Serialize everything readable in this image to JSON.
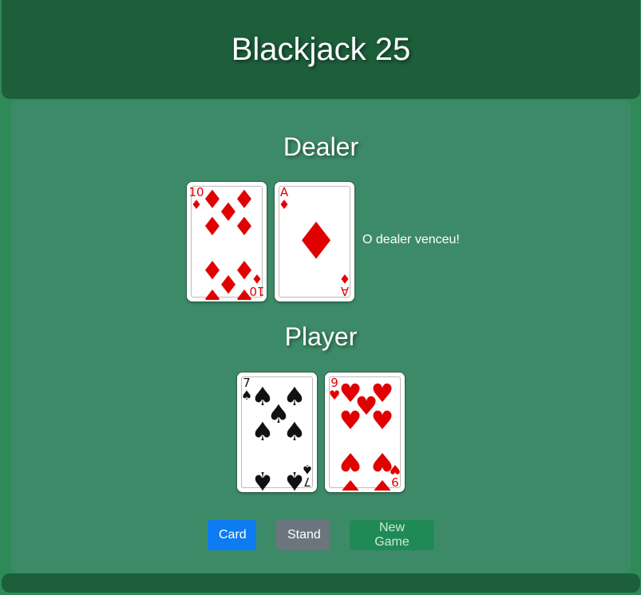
{
  "header": {
    "title": "Blackjack 25"
  },
  "dealer": {
    "title": "Dealer",
    "cards": [
      {
        "rank": "10",
        "suit": "diamonds",
        "color": "red"
      },
      {
        "rank": "A",
        "suit": "diamonds",
        "color": "red"
      }
    ],
    "status": "O dealer venceu!"
  },
  "player": {
    "title": "Player",
    "cards": [
      {
        "rank": "7",
        "suit": "spades",
        "color": "black"
      },
      {
        "rank": "9",
        "suit": "hearts",
        "color": "red"
      }
    ]
  },
  "controls": {
    "card_label": "Card",
    "stand_label": "Stand",
    "new_game_label": "New Game"
  },
  "colors": {
    "background": "#2e8b57",
    "header": "#1d5e3b",
    "table": "#3d8a68",
    "card_button": "#0d7cf2",
    "stand_button": "#6c757d",
    "new_game_button": "#1f8a55",
    "red_suit": "#e00000",
    "black_suit": "#111111"
  }
}
